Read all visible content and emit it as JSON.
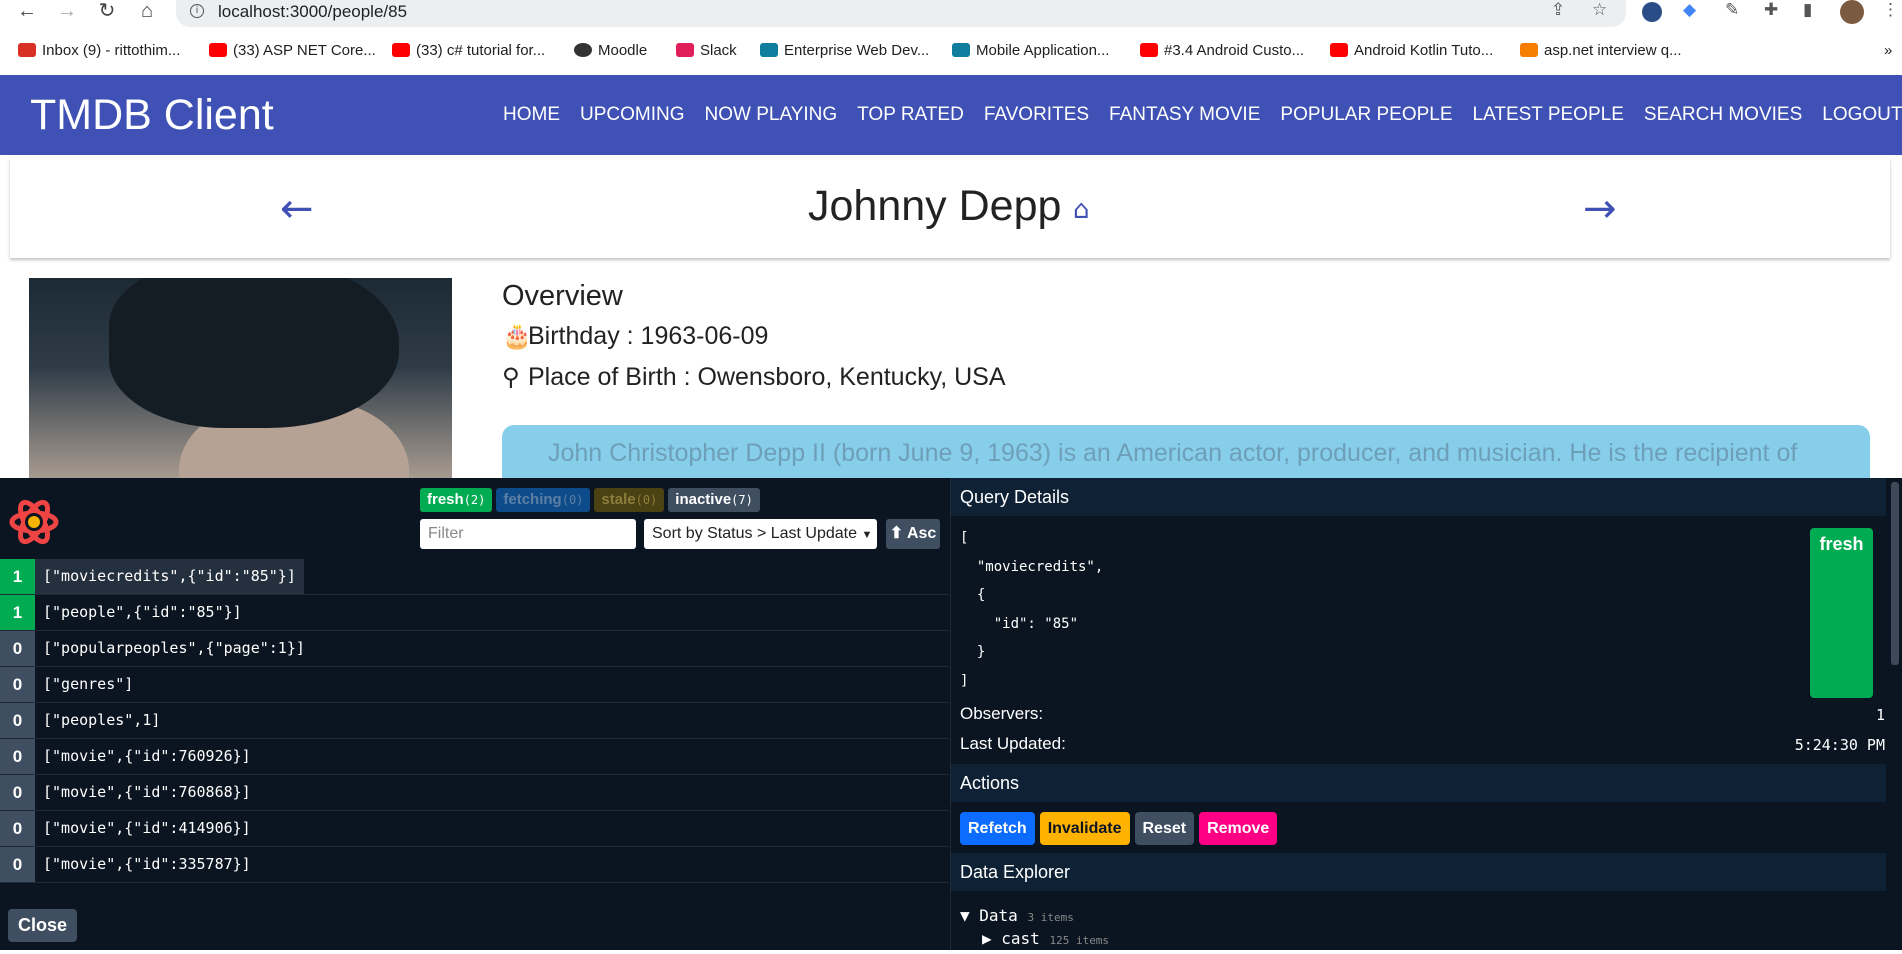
{
  "browser": {
    "url": "localhost:3000/people/85",
    "bookmarks": [
      {
        "label": "Inbox (9) - rittothim...",
        "color": "#d93025"
      },
      {
        "label": "(33) ASP NET Core...",
        "color": "#ff0000"
      },
      {
        "label": "(33) c# tutorial for...",
        "color": "#ff0000"
      },
      {
        "label": "Moodle",
        "color": "#333333"
      },
      {
        "label": "Slack",
        "color": "#e01e5a"
      },
      {
        "label": "Enterprise Web Dev...",
        "color": "#0f7e9e"
      },
      {
        "label": "Mobile Application...",
        "color": "#0f7e9e"
      },
      {
        "label": "#3.4 Android Custo...",
        "color": "#ff0000"
      },
      {
        "label": "Android Kotlin Tuto...",
        "color": "#ff0000"
      },
      {
        "label": "asp.net interview q...",
        "color": "#f57d00"
      }
    ]
  },
  "app": {
    "title": "TMDB Client",
    "nav": [
      "HOME",
      "UPCOMING",
      "NOW PLAYING",
      "TOP RATED",
      "FAVORITES",
      "FANTASY MOVIE",
      "POPULAR PEOPLE",
      "LATEST PEOPLE",
      "SEARCH MOVIES",
      "LOGOUT"
    ],
    "brand_color": "#3f51b5"
  },
  "person": {
    "name": "Johnny Depp",
    "overview_label": "Overview",
    "birthday": "Birthday : 1963-06-09",
    "place_of_birth": "Place of Birth : Owensboro, Kentucky, USA",
    "bio_snippet": "John Christopher Depp II (born June 9, 1963) is an American actor, producer, and musician. He is the recipient of"
  },
  "devtools": {
    "badges": [
      {
        "label": "fresh",
        "count": "(2)",
        "bg": "#00ab52",
        "fg": "#ffffff"
      },
      {
        "label": "fetching",
        "count": "(0)",
        "bg": "#0e4b8a",
        "fg": "#5d7fa3"
      },
      {
        "label": "stale",
        "count": "(0)",
        "bg": "#4b4214",
        "fg": "#8c7e3a"
      },
      {
        "label": "inactive",
        "count": "(7)",
        "bg": "#3f4e60",
        "fg": "#ffffff"
      }
    ],
    "filter_placeholder": "Filter",
    "sort_label": "Sort by Status > Last Update",
    "asc_label": "⬆ Asc",
    "queries": [
      {
        "count": "1",
        "key": "[\"moviecredits\",{\"id\":\"85\"}]",
        "color": "#00ab52"
      },
      {
        "count": "1",
        "key": "[\"people\",{\"id\":\"85\"}]",
        "color": "#00ab52"
      },
      {
        "count": "0",
        "key": "[\"popularpeoples\",{\"page\":1}]",
        "color": "#3f4e60"
      },
      {
        "count": "0",
        "key": "[\"genres\"]",
        "color": "#3f4e60"
      },
      {
        "count": "0",
        "key": "[\"peoples\",1]",
        "color": "#3f4e60"
      },
      {
        "count": "0",
        "key": "[\"movie\",{\"id\":760926}]",
        "color": "#3f4e60"
      },
      {
        "count": "0",
        "key": "[\"movie\",{\"id\":760868}]",
        "color": "#3f4e60"
      },
      {
        "count": "0",
        "key": "[\"movie\",{\"id\":414906}]",
        "color": "#3f4e60"
      },
      {
        "count": "0",
        "key": "[\"movie\",{\"id\":335787}]",
        "color": "#3f4e60"
      }
    ],
    "close_label": "Close",
    "details": {
      "title": "Query Details",
      "code": "[\n  \"moviecredits\",\n  {\n    \"id\": \"85\"\n  }\n]",
      "status": "fresh",
      "observers_label": "Observers:",
      "observers_value": "1",
      "last_updated_label": "Last Updated:",
      "last_updated_value": "5:24:30 PM"
    },
    "actions_title": "Actions",
    "actions": [
      {
        "label": "Refetch",
        "bg": "#0b6cff",
        "fg": "#ffffff"
      },
      {
        "label": "Invalidate",
        "bg": "#ffb200",
        "fg": "#0b1521"
      },
      {
        "label": "Reset",
        "bg": "#3f4e60",
        "fg": "#ffffff"
      },
      {
        "label": "Remove",
        "bg": "#ff0085",
        "fg": "#ffffff"
      }
    ],
    "explorer_title": "Data Explorer",
    "explorer": {
      "root_label": "Data",
      "root_meta": "3 items",
      "child_label": "cast",
      "child_meta": "125 items"
    }
  }
}
